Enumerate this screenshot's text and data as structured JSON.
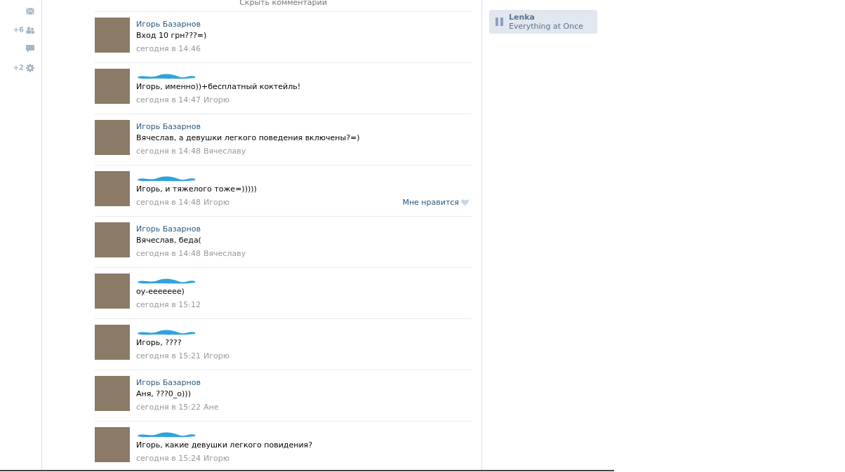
{
  "sidebar": {
    "items": [
      {
        "kind": "mail"
      },
      {
        "kind": "friends",
        "count": "+6"
      },
      {
        "kind": "comments"
      },
      {
        "kind": "settings",
        "count": "+2"
      }
    ]
  },
  "hide_comments": "Скрыть комментарии",
  "comments": [
    {
      "kind": "named",
      "author": "Игорь Базарнов",
      "text": "Вход  10 грн???=)",
      "time": "сегодня в 14:46"
    },
    {
      "kind": "redacted",
      "text": "Игорь, именно))+бесплатный коктейль!",
      "time": "сегодня в 14:47",
      "reply_to": "Игорю"
    },
    {
      "kind": "named",
      "author": "Игорь Базарнов",
      "text": "Вячеслав, а девушки легкого поведения включены?=)",
      "time": "сегодня в 14:48",
      "reply_to": "Вячеславу"
    },
    {
      "kind": "redacted",
      "text": "Игорь, и тяжелого тоже=)))))",
      "time": "сегодня в 14:48",
      "reply_to": "Игорю",
      "like": {
        "label": "Мне нравится",
        "liked": false
      }
    },
    {
      "kind": "named",
      "author": "Игорь Базарнов",
      "text": "Вячеслав, беда(",
      "time": "сегодня в 14:48",
      "reply_to": "Вячеславу"
    },
    {
      "kind": "redacted",
      "text": "оу-еееееее)",
      "time": "сегодня в 15:12"
    },
    {
      "kind": "redacted",
      "text": "Игорь, ????",
      "time": "сегодня в 15:21",
      "reply_to": "Игорю"
    },
    {
      "kind": "named",
      "author": "Игорь Базарнов",
      "text": "Аня, ???0_о)))",
      "time": "сегодня в 15:22",
      "reply_to": "Ане"
    },
    {
      "kind": "redacted",
      "text": "Игорь, какие девушки легкого повидения?",
      "time": "сегодня в 15:24",
      "reply_to": "Игорю"
    }
  ],
  "player": {
    "artist": "Lenka",
    "title": "Everything at Once",
    "playing": true
  }
}
